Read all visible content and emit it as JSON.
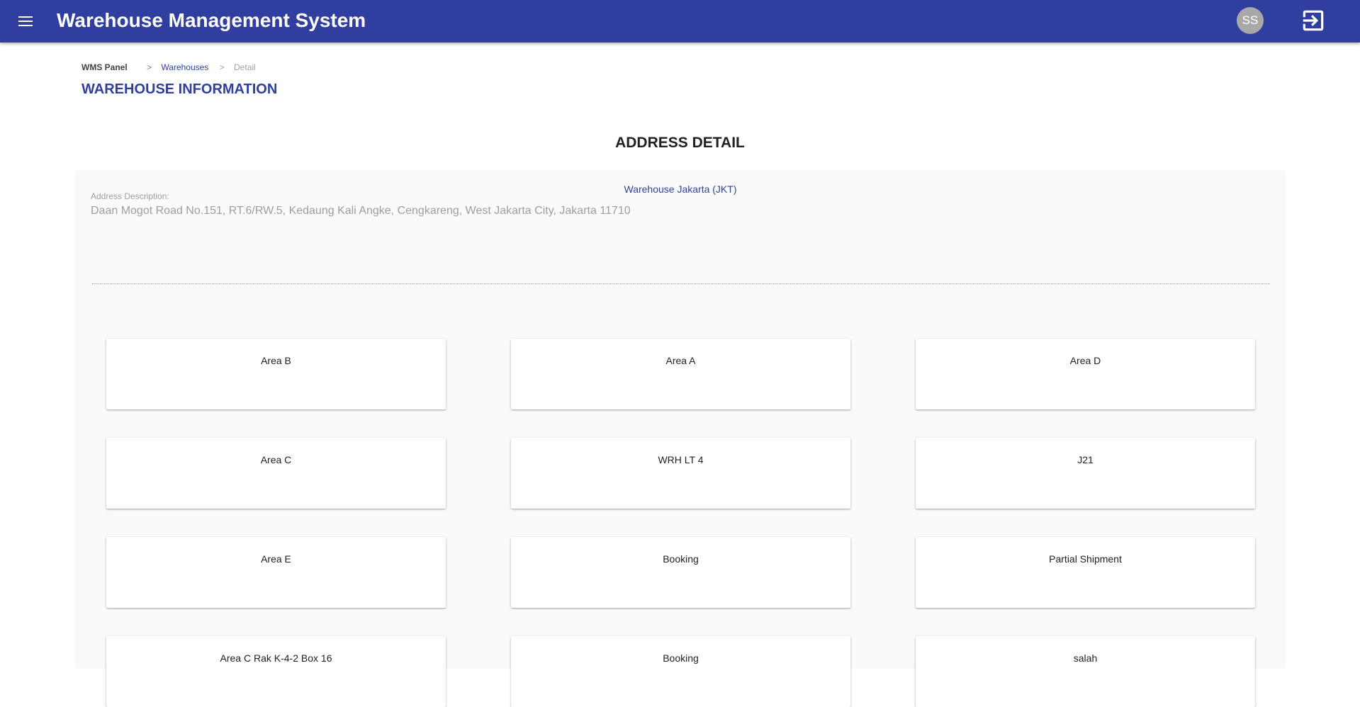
{
  "header": {
    "menu_icon": "hamburger-menu-icon",
    "title": "Warehouse Management System",
    "avatar_initials": "SS",
    "logout_icon": "logout-icon",
    "color": "#303f9f"
  },
  "breadcrumb": {
    "root": "WMS Panel",
    "separator": ">",
    "link": "Warehouses",
    "current": "Detail"
  },
  "page": {
    "title": "WAREHOUSE INFORMATION",
    "section_title": "ADDRESS DETAIL"
  },
  "warehouse": {
    "name": "Warehouse Jakarta (JKT)",
    "address_label": "Address Description:",
    "address": "Daan Mogot Road No.151, RT.6/RW.5, Kedaung Kali Angke, Cengkareng, West Jakarta City, Jakarta 11710"
  },
  "areas": [
    "Area B",
    "Area A",
    "Area D",
    "Area C",
    "WRH LT 4",
    "J21",
    "Area E",
    "Booking",
    "Partial Shipment",
    "Area C Rak K-4-2 Box 16",
    "Booking",
    "salah"
  ]
}
